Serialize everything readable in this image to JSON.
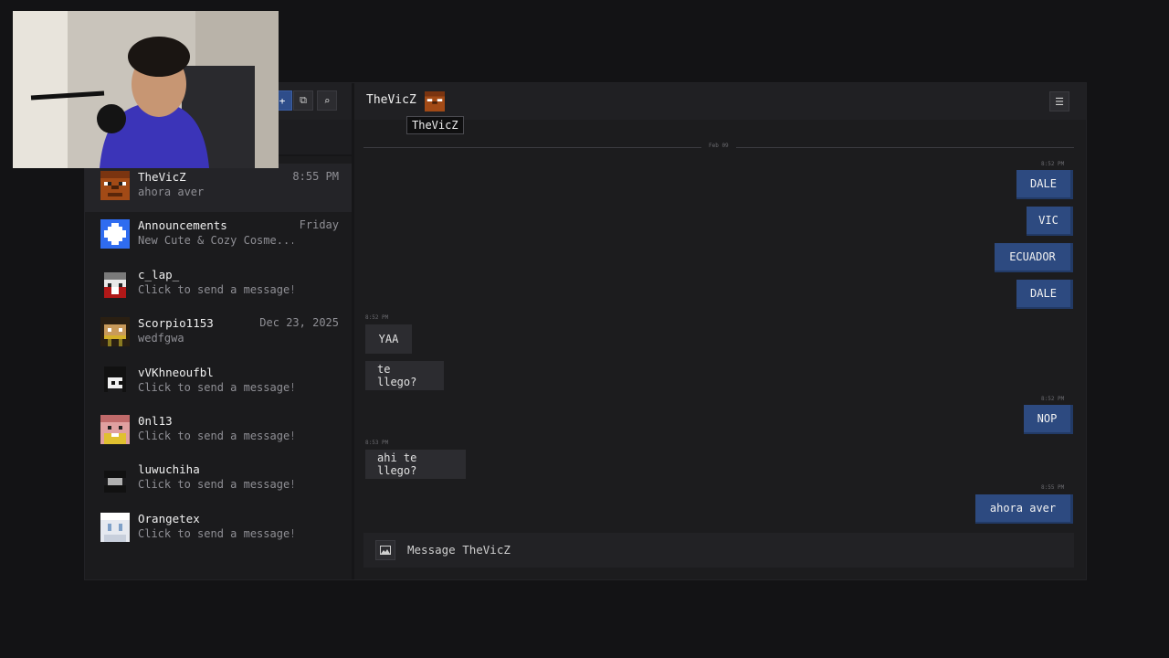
{
  "colors": {
    "background": "#131315",
    "panel": "#1b1b1d",
    "accent_blue": "#2d4a80",
    "bubble_other": "#2c2c30"
  },
  "sidebar": {
    "header_buttons": [
      {
        "icon": "plus-icon",
        "glyph": "+"
      },
      {
        "icon": "new-window-icon",
        "glyph": "⧉"
      },
      {
        "icon": "search-icon",
        "glyph": "⌕"
      }
    ],
    "conversations": [
      {
        "name": "TheVicZ",
        "preview": "ahora aver",
        "time": "8:55 PM"
      },
      {
        "name": "Announcements",
        "preview": "New Cute & Cozy Cosme...",
        "time": "Friday"
      },
      {
        "name": "c_lap_",
        "preview": "Click to send a message!",
        "time": ""
      },
      {
        "name": "Scorpio1153",
        "preview": "wedfgwa",
        "time": "Dec 23, 2025"
      },
      {
        "name": "vVKhneoufbl",
        "preview": "Click to send a message!",
        "time": ""
      },
      {
        "name": "0nl13",
        "preview": "Click to send a message!",
        "time": ""
      },
      {
        "name": "luwuchiha",
        "preview": "Click to send a message!",
        "time": ""
      },
      {
        "name": "Orangetex",
        "preview": "Click to send a message!",
        "time": ""
      }
    ]
  },
  "chat": {
    "title": "TheVicZ",
    "tooltip": "TheVicZ",
    "menu_icon": "menu-icon",
    "date_separator": "Feb 09",
    "timestamps": [
      "8:52 PM",
      "8:52 PM",
      "8:52 PM",
      "8:53 PM",
      "8:55 PM"
    ],
    "messages": [
      {
        "from": "me",
        "text": "DALE"
      },
      {
        "from": "me",
        "text": "VIC"
      },
      {
        "from": "me",
        "text": "ECUADOR"
      },
      {
        "from": "me",
        "text": "DALE"
      },
      {
        "from": "them",
        "text": "YAA"
      },
      {
        "from": "them",
        "text": "te llego?"
      },
      {
        "from": "me",
        "text": "NOP"
      },
      {
        "from": "them",
        "text": "ahi te llego?"
      },
      {
        "from": "me",
        "text": "ahora aver"
      }
    ],
    "input_placeholder": "Message TheVicZ",
    "input_icon": "image-icon"
  }
}
